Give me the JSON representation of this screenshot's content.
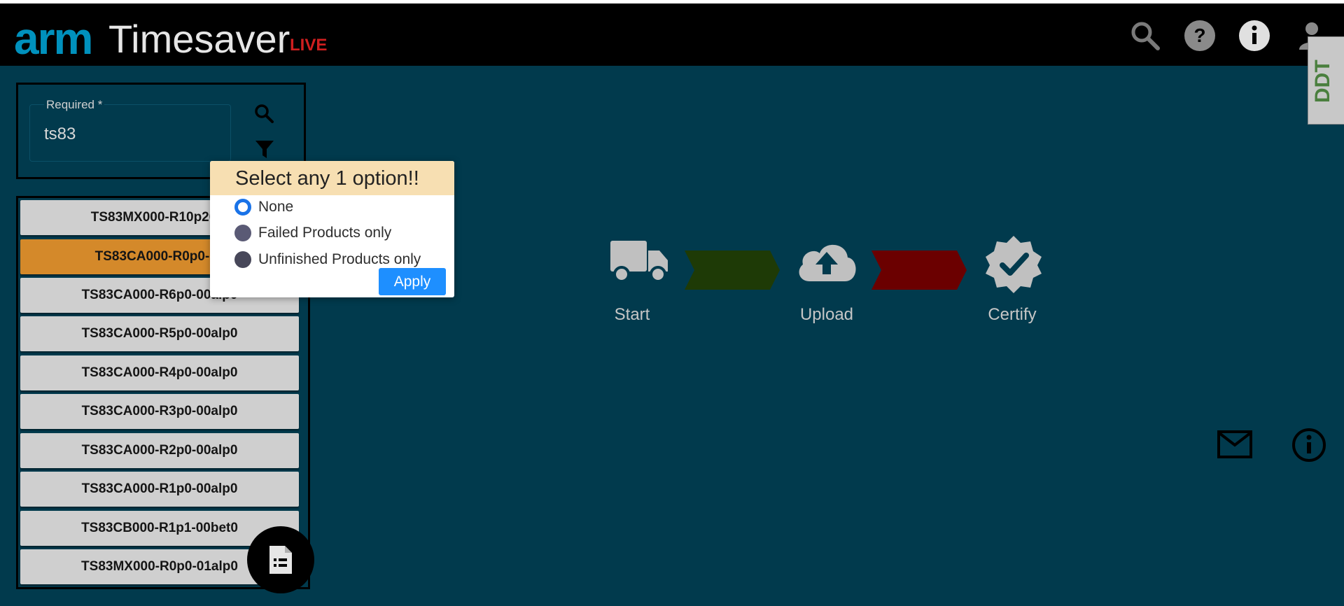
{
  "header": {
    "logo_brand": "arm",
    "app_title": "Timesaver",
    "env_badge": "LIVE",
    "icons": [
      "search-icon",
      "help-icon",
      "info-icon",
      "user-icon"
    ],
    "extension_badge": "DDT"
  },
  "search": {
    "label": "Required *",
    "value": "ts83"
  },
  "product_list": [
    {
      "label": "TS83MX000-R10p20-0",
      "active": false
    },
    {
      "label": "TS83CA000-R0p0-00",
      "active": true
    },
    {
      "label": "TS83CA000-R6p0-00alp0",
      "active": false
    },
    {
      "label": "TS83CA000-R5p0-00alp0",
      "active": false
    },
    {
      "label": "TS83CA000-R4p0-00alp0",
      "active": false
    },
    {
      "label": "TS83CA000-R3p0-00alp0",
      "active": false
    },
    {
      "label": "TS83CA000-R2p0-00alp0",
      "active": false
    },
    {
      "label": "TS83CA000-R1p0-00alp0",
      "active": false
    },
    {
      "label": "TS83CB000-R1p1-00bet0",
      "active": false
    },
    {
      "label": "TS83MX000-R0p0-01alp0",
      "active": false
    }
  ],
  "filter_popup": {
    "title": "Select any 1 option!!",
    "options": [
      {
        "label": "None",
        "checked": true
      },
      {
        "label": "Failed Products only",
        "checked": false
      },
      {
        "label": "Unfinished Products only",
        "checked": false
      }
    ],
    "apply_label": "Apply"
  },
  "workflow": {
    "steps": [
      {
        "label": "Start",
        "icon": "truck-icon"
      },
      {
        "label": "Upload",
        "icon": "cloud-upload-icon"
      },
      {
        "label": "Certify",
        "icon": "certified-badge-icon"
      }
    ],
    "connector_colors": [
      "#1e3a06",
      "#6b0000"
    ]
  },
  "side_actions": [
    "mail-icon",
    "info-outline-icon"
  ],
  "colors": {
    "background": "#013a4d",
    "header": "#000000",
    "active_item": "#d4892a",
    "apply_button": "#1e8fff",
    "live_badge": "#d01f1f"
  }
}
